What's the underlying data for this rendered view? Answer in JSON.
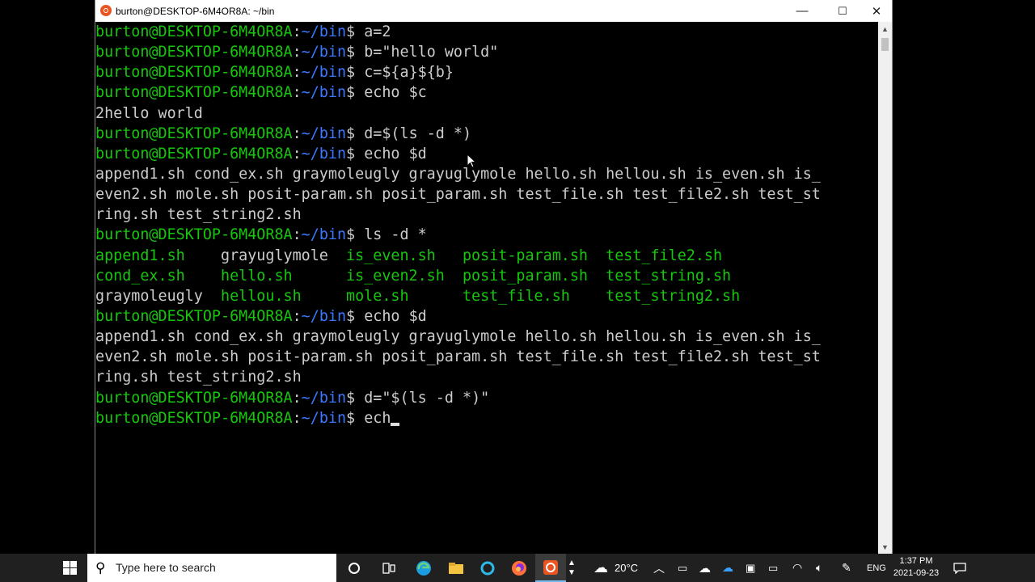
{
  "window": {
    "title": "burton@DESKTOP-6M4OR8A: ~/bin",
    "minimize_glyph": "—",
    "maximize_glyph": "☐",
    "close_glyph": "✕"
  },
  "prompt": {
    "user_host": "burton@DESKTOP-6M4OR8A",
    "colon": ":",
    "path": "~/bin",
    "dollar": "$ "
  },
  "terminal_lines": [
    {
      "type": "cmd",
      "text": "a=2"
    },
    {
      "type": "cmd",
      "text": "b=\"hello world\""
    },
    {
      "type": "cmd",
      "text": "c=${a}${b}"
    },
    {
      "type": "cmd",
      "text": "echo $c"
    },
    {
      "type": "out",
      "text": "2hello world"
    },
    {
      "type": "cmd",
      "text": "d=$(ls -d *)"
    },
    {
      "type": "cmd",
      "text": "echo $d"
    },
    {
      "type": "out",
      "text": "append1.sh cond_ex.sh graymoleugly grayuglymole hello.sh hellou.sh is_even.sh is_"
    },
    {
      "type": "out",
      "text": "even2.sh mole.sh posit-param.sh posit_param.sh test_file.sh test_file2.sh test_st"
    },
    {
      "type": "out",
      "text": "ring.sh test_string2.sh"
    },
    {
      "type": "cmd",
      "text": "ls -d *"
    },
    {
      "type": "ls",
      "cells": [
        {
          "text": "append1.sh    ",
          "color": "g"
        },
        {
          "text": "grayuglymole  ",
          "color": "w"
        },
        {
          "text": "is_even.sh   ",
          "color": "g"
        },
        {
          "text": "posit-param.sh  ",
          "color": "g"
        },
        {
          "text": "test_file2.sh",
          "color": "g"
        }
      ]
    },
    {
      "type": "ls",
      "cells": [
        {
          "text": "cond_ex.sh    ",
          "color": "g"
        },
        {
          "text": "hello.sh      ",
          "color": "g"
        },
        {
          "text": "is_even2.sh  ",
          "color": "g"
        },
        {
          "text": "posit_param.sh  ",
          "color": "g"
        },
        {
          "text": "test_string.sh",
          "color": "g"
        }
      ]
    },
    {
      "type": "ls",
      "cells": [
        {
          "text": "graymoleugly  ",
          "color": "w"
        },
        {
          "text": "hellou.sh     ",
          "color": "g"
        },
        {
          "text": "mole.sh      ",
          "color": "g"
        },
        {
          "text": "test_file.sh    ",
          "color": "g"
        },
        {
          "text": "test_string2.sh",
          "color": "g"
        }
      ]
    },
    {
      "type": "cmd",
      "text": "echo $d"
    },
    {
      "type": "out",
      "text": "append1.sh cond_ex.sh graymoleugly grayuglymole hello.sh hellou.sh is_even.sh is_"
    },
    {
      "type": "out",
      "text": "even2.sh mole.sh posit-param.sh posit_param.sh test_file.sh test_file2.sh test_st"
    },
    {
      "type": "out",
      "text": "ring.sh test_string2.sh"
    },
    {
      "type": "cmd",
      "text": "d=\"$(ls -d *)\""
    },
    {
      "type": "cmd",
      "text": "ech",
      "cursor": true
    }
  ],
  "taskbar": {
    "search_placeholder": "Type here to search",
    "temperature": "20°C",
    "language": "ENG",
    "time": "1:37 PM",
    "date": "2021-09-23"
  },
  "colors": {
    "prompt_green": "#16c60c",
    "path_blue": "#3b78ff",
    "text": "#cccccc",
    "ubuntu_orange": "#e95420"
  },
  "icons": [
    "windows-start-icon",
    "search-icon",
    "cortana-icon",
    "task-view-icon",
    "edge-icon",
    "file-explorer-icon",
    "cortana-ring-icon",
    "firefox-icon",
    "ubuntu-icon",
    "weather-icon",
    "chevron-up-icon",
    "meet-now-icon",
    "onedrive-icon",
    "cloud-icon",
    "app-tray-icon",
    "battery-icon",
    "wifi-icon",
    "volume-icon",
    "pen-icon",
    "notification-icon"
  ]
}
